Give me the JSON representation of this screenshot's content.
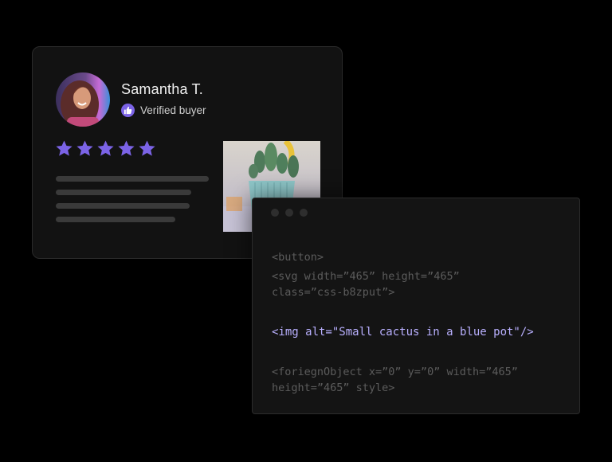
{
  "review": {
    "reviewer_name": "Samantha T.",
    "verified_label": "Verified buyer",
    "rating": 5,
    "rating_max": 5,
    "icons": {
      "avatar": "avatar",
      "badge": "thumbs-up-icon",
      "star": "star-icon",
      "product": "cactus-image"
    },
    "colors": {
      "accent": "#7b63e6",
      "star": "#7b63e6",
      "card_bg": "#121212"
    }
  },
  "code": {
    "lines": [
      "<button>",
      "<svg width=”465” height=”465”",
      "class=”css-b8zput”>",
      "<img alt=\"Small cactus in a blue pot\"/>",
      "<foriegnObject x=”0” y=”0” width=”465”",
      "height=”465” style>"
    ],
    "colors": {
      "highlight": "#b9b0ff",
      "dim": "#5c5c5c"
    }
  }
}
